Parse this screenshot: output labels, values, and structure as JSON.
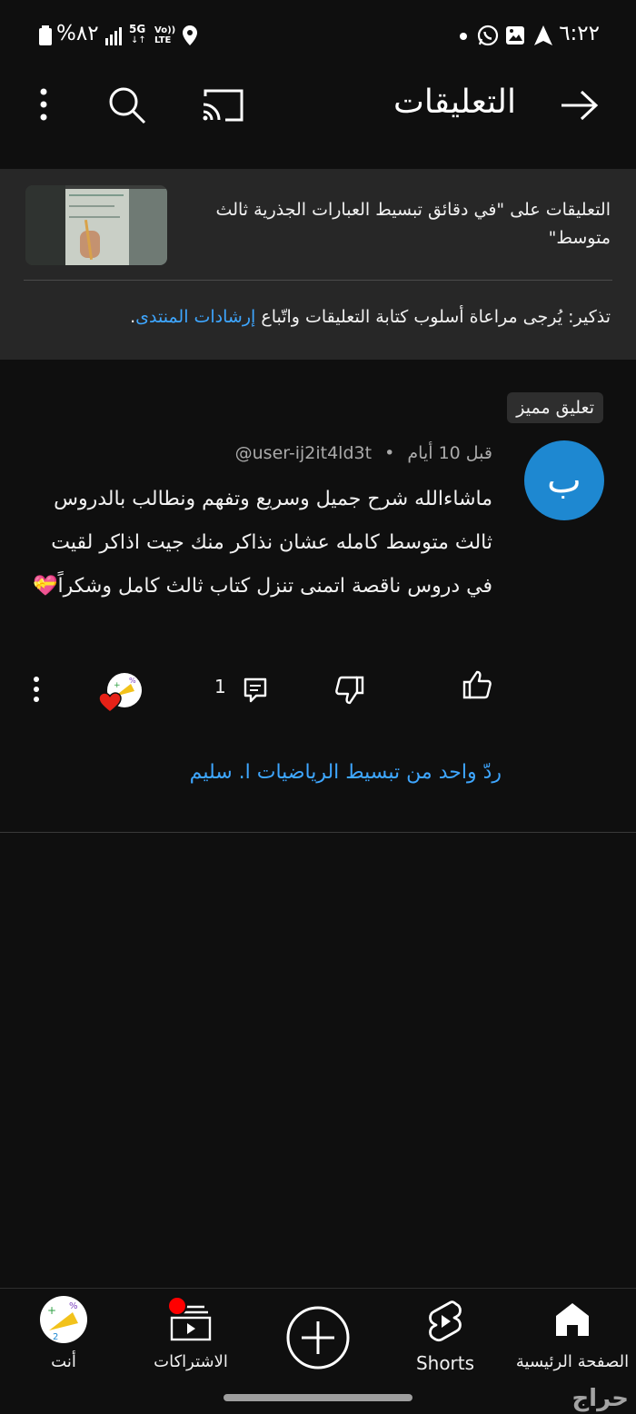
{
  "status_bar": {
    "time": "٦:٢٢",
    "battery": "%٨٢",
    "network_5g": "5G",
    "network_volte": "Vo)) LTE"
  },
  "header": {
    "title": "التعليقات"
  },
  "info_panel": {
    "title": "التعليقات على \"في دقائق تبسيط العبارات الجذرية ثالث متوسط\"",
    "note_prefix": "تذكير: يُرجى مراعاة أسلوب كتابة التعليقات واتّباع ",
    "note_link": "إرشادات المنتدى",
    "note_suffix": "."
  },
  "comment": {
    "pinned_label": "تعليق مميز",
    "avatar_letter": "ب",
    "author": "@user-ij2it4ld3t",
    "time_ago": "قبل 10 أيام",
    "separator": "•",
    "text": "ماشاءالله شرح جميل وسريع وتفهم ونطالب بالدروس ثالث متوسط كامله عشان نذاكر منك جيت اذاكر لقيت في دروس ناقصة اتمنى تنزل كتاب ثالث كامل وشكراً💝",
    "reply_count": "1",
    "reply_link": "ردّ واحد من تبسيط الرياضيات  ا. سليم"
  },
  "bottom_nav": {
    "home": "الصفحة الرئيسية",
    "shorts": "Shorts",
    "subscriptions": "الاشتراكات",
    "you": "أنت"
  },
  "watermark": "حراج",
  "colors": {
    "background": "#0f0f0f",
    "panel": "#272727",
    "link": "#3ea6ff",
    "avatar": "#1e88d1",
    "notification_dot": "#ff0000"
  }
}
